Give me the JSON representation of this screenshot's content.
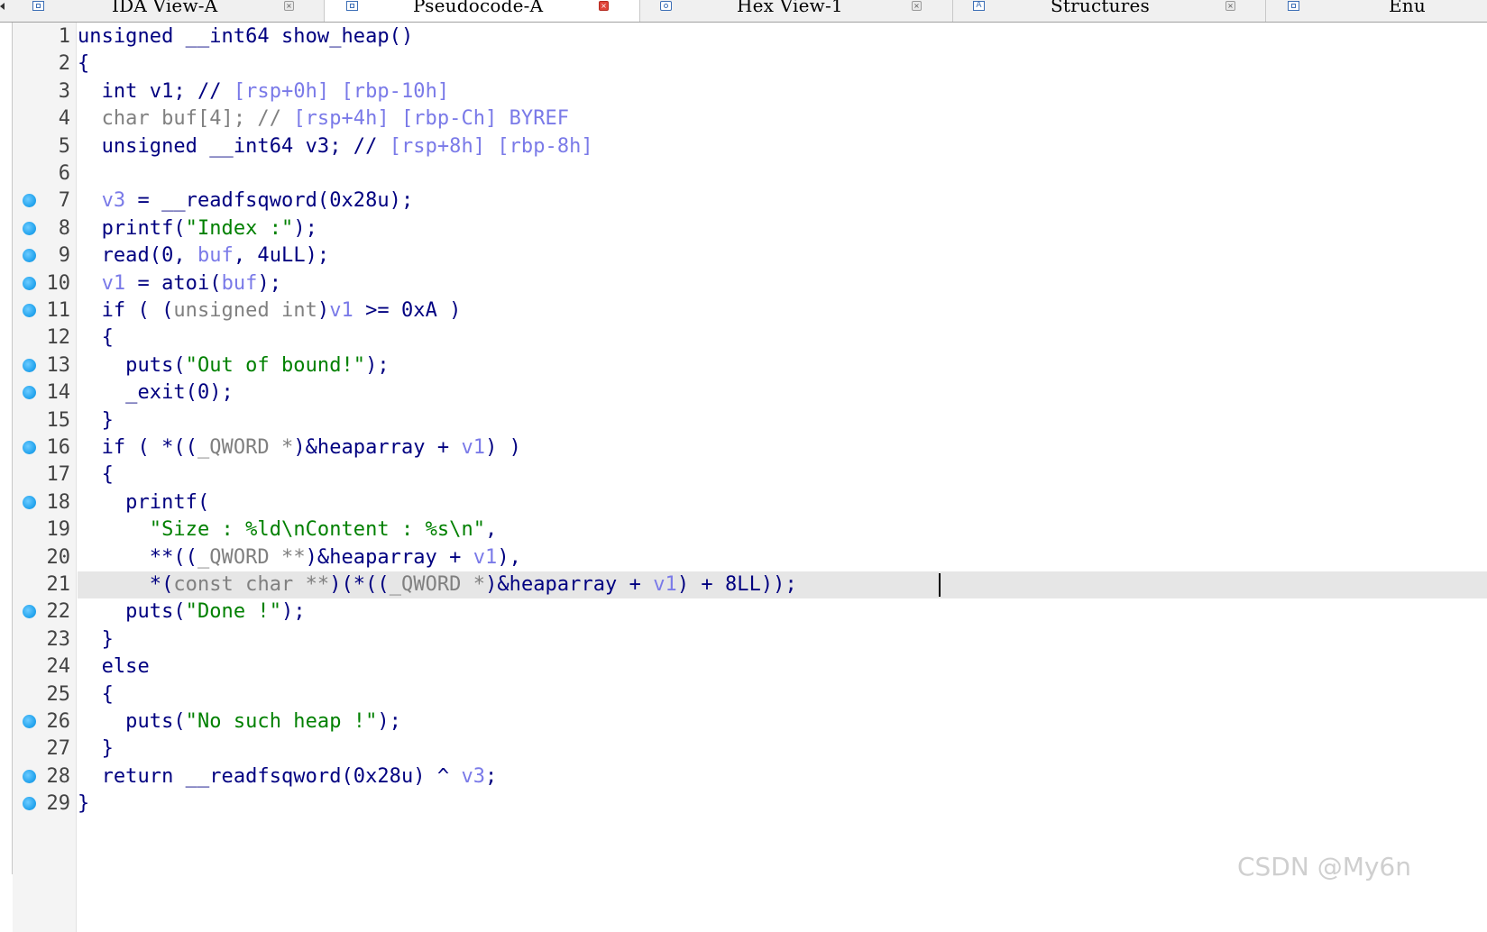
{
  "tabs": [
    {
      "label": "IDA View-A",
      "icon": "ida-view-icon",
      "active": false
    },
    {
      "label": "Pseudocode-A",
      "icon": "pseudocode-icon",
      "active": true
    },
    {
      "label": "Hex View-1",
      "icon": "hex-view-icon",
      "active": false
    },
    {
      "label": "Structures",
      "icon": "structures-icon",
      "active": false
    },
    {
      "label": "Enu",
      "icon": "enums-icon",
      "active": false
    }
  ],
  "colors": {
    "identifier": "#000080",
    "comment_gray": "#808080",
    "variable": "#7a7ae8",
    "string": "#008000",
    "breakpoint": "#27a6ef",
    "current_line": "#e6e6e6"
  },
  "editor": {
    "current_line": 21,
    "lines": [
      {
        "n": "1",
        "bp": false,
        "tokens": [
          {
            "t": "unsigned __int64 show_heap()",
            "c": "id"
          }
        ]
      },
      {
        "n": "2",
        "bp": false,
        "tokens": [
          {
            "t": "{",
            "c": "id"
          }
        ]
      },
      {
        "n": "3",
        "bp": false,
        "tokens": [
          {
            "t": "  int v1; // ",
            "c": "id"
          },
          {
            "t": "[rsp+0h] [rbp-10h]",
            "c": "var"
          }
        ]
      },
      {
        "n": "4",
        "bp": false,
        "tokens": [
          {
            "t": "  char buf[4]; // ",
            "c": "gr"
          },
          {
            "t": "[rsp+4h] [rbp-Ch] BYREF",
            "c": "var"
          }
        ]
      },
      {
        "n": "5",
        "bp": false,
        "tokens": [
          {
            "t": "  unsigned __int64 v3; // ",
            "c": "id"
          },
          {
            "t": "[rsp+8h] [rbp-8h]",
            "c": "var"
          }
        ]
      },
      {
        "n": "6",
        "bp": false,
        "tokens": [
          {
            "t": "",
            "c": "id"
          }
        ]
      },
      {
        "n": "7",
        "bp": true,
        "tokens": [
          {
            "t": "  ",
            "c": "id"
          },
          {
            "t": "v3",
            "c": "var"
          },
          {
            "t": " = __readfsqword(0x28u);",
            "c": "id"
          }
        ]
      },
      {
        "n": "8",
        "bp": true,
        "tokens": [
          {
            "t": "  printf(",
            "c": "id"
          },
          {
            "t": "\"Index :\"",
            "c": "str"
          },
          {
            "t": ");",
            "c": "id"
          }
        ]
      },
      {
        "n": "9",
        "bp": true,
        "tokens": [
          {
            "t": "  read(0, ",
            "c": "id"
          },
          {
            "t": "buf",
            "c": "var"
          },
          {
            "t": ", 4uLL);",
            "c": "id"
          }
        ]
      },
      {
        "n": "10",
        "bp": true,
        "tokens": [
          {
            "t": "  ",
            "c": "id"
          },
          {
            "t": "v1",
            "c": "var"
          },
          {
            "t": " = atoi(",
            "c": "id"
          },
          {
            "t": "buf",
            "c": "var"
          },
          {
            "t": ");",
            "c": "id"
          }
        ]
      },
      {
        "n": "11",
        "bp": true,
        "tokens": [
          {
            "t": "  if ( (",
            "c": "id"
          },
          {
            "t": "unsigned int",
            "c": "gr"
          },
          {
            "t": ")",
            "c": "id"
          },
          {
            "t": "v1",
            "c": "var"
          },
          {
            "t": " >= 0xA )",
            "c": "id"
          }
        ]
      },
      {
        "n": "12",
        "bp": false,
        "tokens": [
          {
            "t": "  {",
            "c": "id"
          }
        ]
      },
      {
        "n": "13",
        "bp": true,
        "tokens": [
          {
            "t": "    puts(",
            "c": "id"
          },
          {
            "t": "\"Out of bound!\"",
            "c": "str"
          },
          {
            "t": ");",
            "c": "id"
          }
        ]
      },
      {
        "n": "14",
        "bp": true,
        "tokens": [
          {
            "t": "    _exit(0);",
            "c": "id"
          }
        ]
      },
      {
        "n": "15",
        "bp": false,
        "tokens": [
          {
            "t": "  }",
            "c": "id"
          }
        ]
      },
      {
        "n": "16",
        "bp": true,
        "tokens": [
          {
            "t": "  if ( *((",
            "c": "id"
          },
          {
            "t": "_QWORD *",
            "c": "gr"
          },
          {
            "t": ")&heaparray + ",
            "c": "id"
          },
          {
            "t": "v1",
            "c": "var"
          },
          {
            "t": ") )",
            "c": "id"
          }
        ]
      },
      {
        "n": "17",
        "bp": false,
        "tokens": [
          {
            "t": "  {",
            "c": "id"
          }
        ]
      },
      {
        "n": "18",
        "bp": true,
        "tokens": [
          {
            "t": "    printf(",
            "c": "id"
          }
        ]
      },
      {
        "n": "19",
        "bp": false,
        "tokens": [
          {
            "t": "      ",
            "c": "id"
          },
          {
            "t": "\"Size : %ld\\nContent : %s\\n\"",
            "c": "str"
          },
          {
            "t": ",",
            "c": "id"
          }
        ]
      },
      {
        "n": "20",
        "bp": false,
        "tokens": [
          {
            "t": "      **((",
            "c": "id"
          },
          {
            "t": "_QWORD **",
            "c": "gr"
          },
          {
            "t": ")&heaparray + ",
            "c": "id"
          },
          {
            "t": "v1",
            "c": "var"
          },
          {
            "t": "),",
            "c": "id"
          }
        ]
      },
      {
        "n": "21",
        "bp": false,
        "tokens": [
          {
            "t": "      *(",
            "c": "id"
          },
          {
            "t": "const char **",
            "c": "gr"
          },
          {
            "t": ")(*((",
            "c": "id"
          },
          {
            "t": "_QWORD *",
            "c": "gr"
          },
          {
            "t": ")&heaparray + ",
            "c": "id"
          },
          {
            "t": "v1",
            "c": "var"
          },
          {
            "t": ") + 8LL));",
            "c": "id"
          }
        ]
      },
      {
        "n": "22",
        "bp": true,
        "tokens": [
          {
            "t": "    puts(",
            "c": "id"
          },
          {
            "t": "\"Done !\"",
            "c": "str"
          },
          {
            "t": ");",
            "c": "id"
          }
        ]
      },
      {
        "n": "23",
        "bp": false,
        "tokens": [
          {
            "t": "  }",
            "c": "id"
          }
        ]
      },
      {
        "n": "24",
        "bp": false,
        "tokens": [
          {
            "t": "  else",
            "c": "id"
          }
        ]
      },
      {
        "n": "25",
        "bp": false,
        "tokens": [
          {
            "t": "  {",
            "c": "id"
          }
        ]
      },
      {
        "n": "26",
        "bp": true,
        "tokens": [
          {
            "t": "    puts(",
            "c": "id"
          },
          {
            "t": "\"No such heap !\"",
            "c": "str"
          },
          {
            "t": ");",
            "c": "id"
          }
        ]
      },
      {
        "n": "27",
        "bp": false,
        "tokens": [
          {
            "t": "  }",
            "c": "id"
          }
        ]
      },
      {
        "n": "28",
        "bp": true,
        "tokens": [
          {
            "t": "  return __readfsqword(0x28u) ^ ",
            "c": "id"
          },
          {
            "t": "v3",
            "c": "var"
          },
          {
            "t": ";",
            "c": "id"
          }
        ]
      },
      {
        "n": "29",
        "bp": true,
        "tokens": [
          {
            "t": "}",
            "c": "id"
          }
        ]
      }
    ]
  },
  "watermark": "CSDN @My6n"
}
